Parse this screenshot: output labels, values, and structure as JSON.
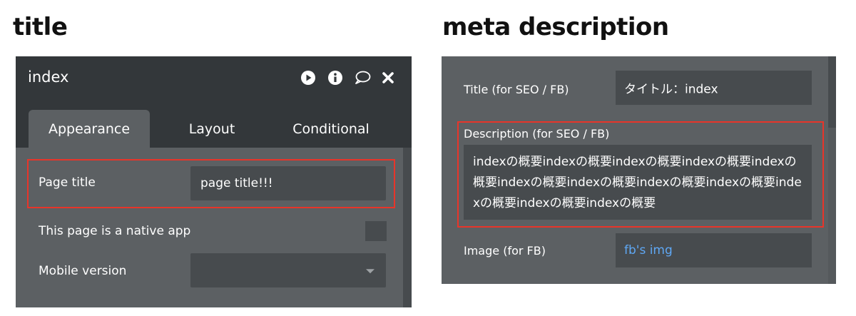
{
  "headings": {
    "left": "title",
    "right": "meta description"
  },
  "left_panel": {
    "window_title": "index",
    "icons": [
      "play-icon",
      "info-icon",
      "comment-icon",
      "close-icon"
    ],
    "tabs": [
      {
        "label": "Appearance",
        "active": true
      },
      {
        "label": "Layout",
        "active": false
      },
      {
        "label": "Conditional",
        "active": false
      }
    ],
    "page_title": {
      "label": "Page title",
      "value": "page title!!!"
    },
    "native_app": {
      "label": "This page is a native app",
      "checked": false
    },
    "mobile_version": {
      "label": "Mobile version",
      "value": ""
    }
  },
  "right_panel": {
    "seo_title": {
      "label": "Title (for SEO / FB)",
      "value": "タイトル：index"
    },
    "description": {
      "label": "Description (for SEO / FB)",
      "value": "indexの概要indexの概要indexの概要indexの概要indexの概要indexの概要indexの概要indexの概要indexの概要indexの概要indexの概要indexの概要"
    },
    "image": {
      "label": "Image (for FB)",
      "value": "fb's img"
    }
  },
  "colors": {
    "panel_bg": "#5c6063",
    "header_bg": "#33373a",
    "field_bg": "#474b4e",
    "highlight_border": "#e8352a",
    "link": "#5fa8f5"
  }
}
